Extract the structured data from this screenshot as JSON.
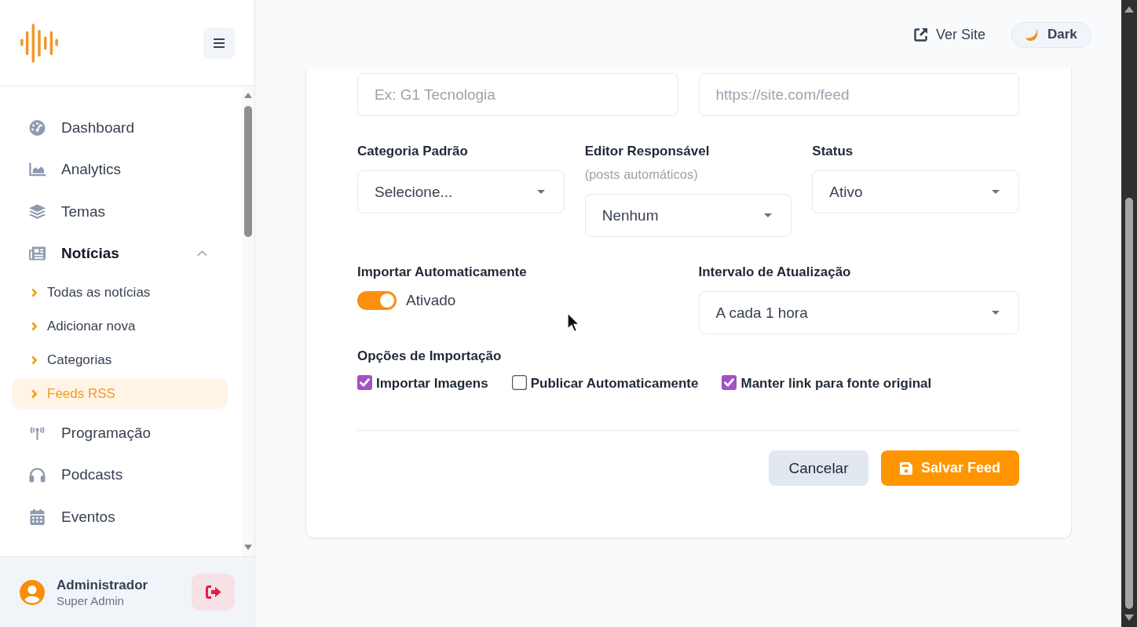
{
  "sidebar": {
    "nav": [
      {
        "label": "Dashboard",
        "selected": false
      },
      {
        "label": "Analytics",
        "selected": false
      },
      {
        "label": "Temas",
        "selected": false
      },
      {
        "label": "Notícias",
        "selected": false,
        "expanded": true,
        "children": [
          {
            "label": "Todas as notícias",
            "selected": false
          },
          {
            "label": "Adicionar nova",
            "selected": false
          },
          {
            "label": "Categorias",
            "selected": false
          },
          {
            "label": "Feeds RSS",
            "selected": true
          }
        ]
      },
      {
        "label": "Programação",
        "selected": false
      },
      {
        "label": "Podcasts",
        "selected": false
      },
      {
        "label": "Eventos",
        "selected": false
      }
    ],
    "user": {
      "name": "Administrador",
      "role": "Super Admin"
    }
  },
  "header": {
    "view_site": "Ver Site",
    "theme_toggle": "Dark"
  },
  "form": {
    "inputs": [
      {
        "placeholder": "Ex: G1 Tecnologia"
      },
      {
        "placeholder": "https://site.com/feed"
      }
    ],
    "selects": [
      {
        "label": "Categoria Padrão",
        "value": "Selecione..."
      },
      {
        "label": "Editor Responsável",
        "hint": "(posts automáticos)",
        "value": "Nenhum"
      },
      {
        "label": "Status",
        "value": "Ativo"
      }
    ],
    "auto_import": {
      "label": "Importar Automaticamente",
      "on": true,
      "status": "Ativado"
    },
    "interval": {
      "label": "Intervalo de Atualização",
      "value": "A cada 1 hora"
    },
    "options": {
      "label": "Opções de Importação",
      "items": [
        {
          "label": "Importar Imagens",
          "checked": true
        },
        {
          "label": "Publicar Automaticamente",
          "checked": false
        },
        {
          "label": "Manter link para fonte original",
          "checked": true
        }
      ]
    },
    "buttons": [
      {
        "kind": "secondary",
        "label": "Cancelar"
      },
      {
        "kind": "primary",
        "label": "Salvar Feed"
      }
    ]
  }
}
